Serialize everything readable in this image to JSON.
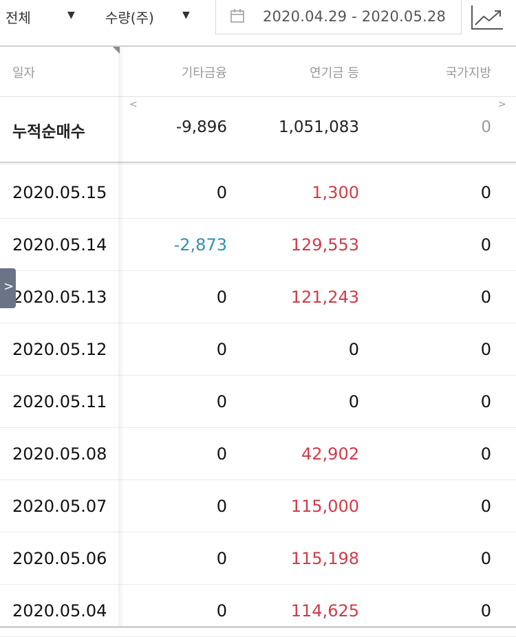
{
  "toolbar": {
    "filter_all": "전체",
    "filter_unit": "수량(주)",
    "date_range": "2020.04.29 - 2020.05.28",
    "chart_icon": "line-chart-icon",
    "calendar_icon": "calendar-icon",
    "dropdown_icon": "caret-down-icon"
  },
  "columns": [
    "일자",
    "기타금융",
    "연기금 등",
    "국가지방"
  ],
  "summary": {
    "label": "누적순매수",
    "values": [
      "-9,896",
      "1,051,083",
      "0"
    ]
  },
  "nav": {
    "prev": "<",
    "next": ">"
  },
  "side_tab": {
    "glyph": ">"
  },
  "rows": [
    {
      "date": "2020.05.15",
      "v1": "0",
      "v2": "1,300",
      "v3": "0"
    },
    {
      "date": "2020.05.14",
      "v1": "-2,873",
      "v2": "129,553",
      "v3": "0"
    },
    {
      "date": "2020.05.13",
      "v1": "0",
      "v2": "121,243",
      "v3": "0"
    },
    {
      "date": "2020.05.12",
      "v1": "0",
      "v2": "0",
      "v3": "0"
    },
    {
      "date": "2020.05.11",
      "v1": "0",
      "v2": "0",
      "v3": "0"
    },
    {
      "date": "2020.05.08",
      "v1": "0",
      "v2": "42,902",
      "v3": "0"
    },
    {
      "date": "2020.05.07",
      "v1": "0",
      "v2": "115,000",
      "v3": "0"
    },
    {
      "date": "2020.05.06",
      "v1": "0",
      "v2": "115,198",
      "v3": "0"
    },
    {
      "date": "2020.05.04",
      "v1": "0",
      "v2": "114,625",
      "v3": "0"
    }
  ],
  "colors": {
    "positive": "#d13b47",
    "negative": "#2f90b8"
  }
}
